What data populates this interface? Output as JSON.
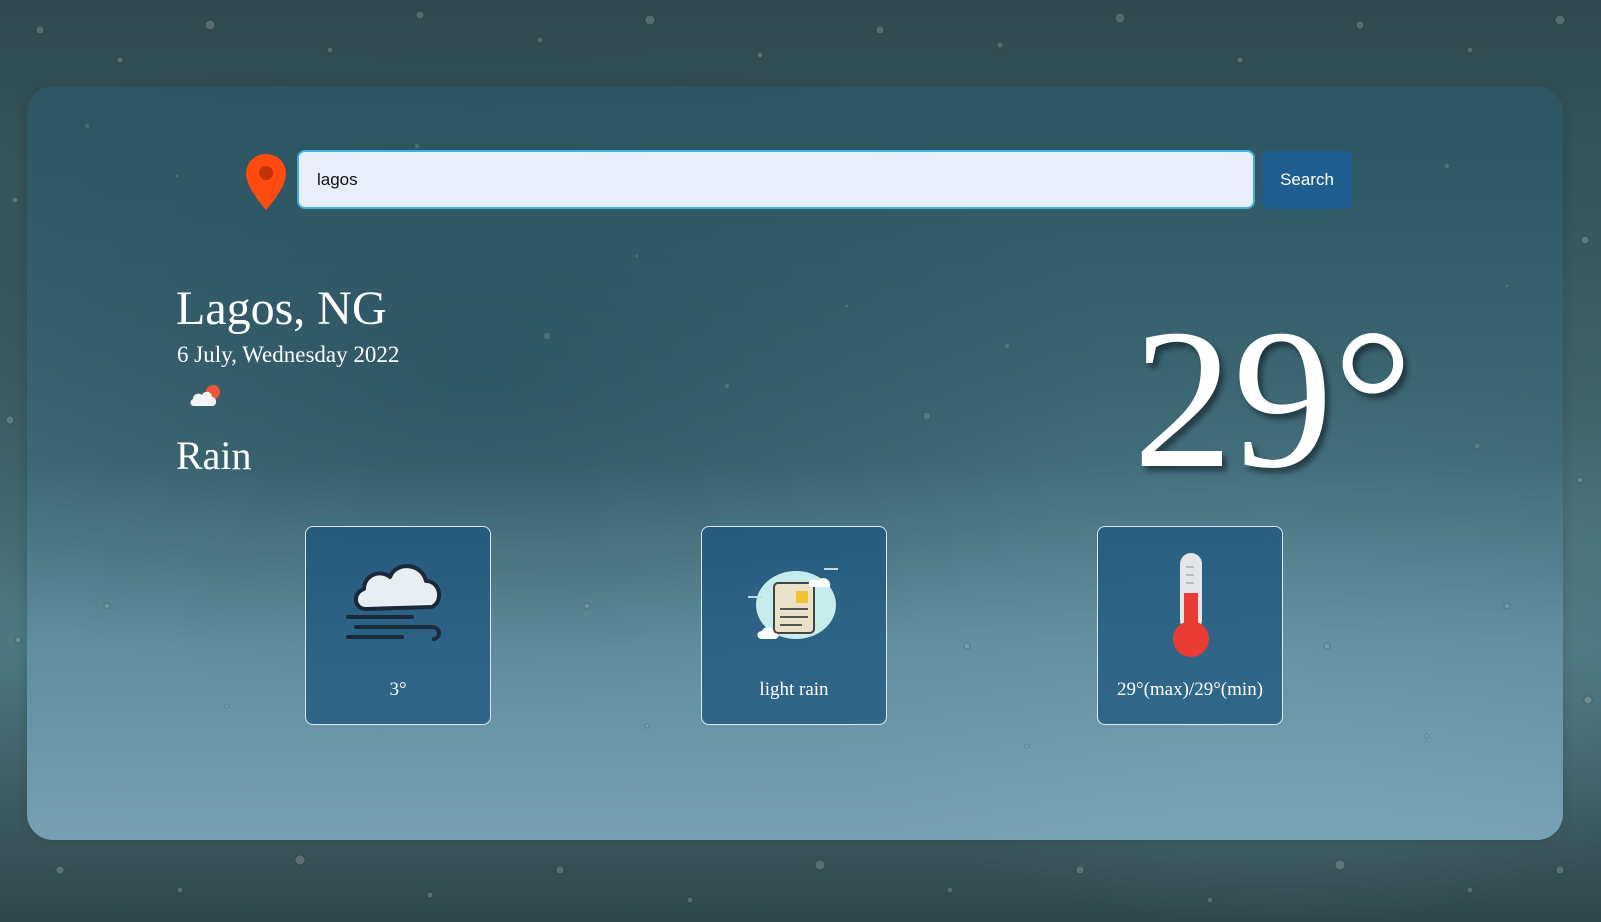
{
  "search": {
    "value": "lagos",
    "button_label": "Search"
  },
  "location": {
    "city": "Lagos, NG",
    "date": "6 July, Wednesday 2022"
  },
  "weather": {
    "condition": "Rain",
    "temperature": "29°"
  },
  "cards": {
    "wind": {
      "label": "3°",
      "icon": "wind-cloud-icon"
    },
    "description": {
      "label": "light rain",
      "icon": "cloud-report-icon"
    },
    "temperature": {
      "label": "29°(max)/29°(min)",
      "icon": "thermometer-icon"
    }
  },
  "colors": {
    "accent": "#1f5f8f",
    "pin": "#ff4a10",
    "input_bg": "#e8eefa",
    "input_border": "#3fb0e0"
  }
}
